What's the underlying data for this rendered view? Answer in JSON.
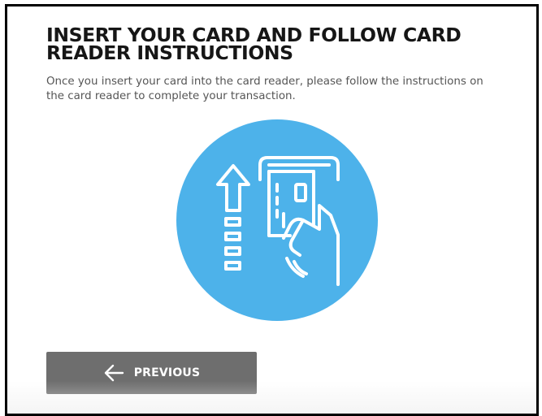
{
  "header": {
    "title": "INSERT YOUR CARD AND FOLLOW CARD READER INSTRUCTIONS"
  },
  "main": {
    "description": "Once you insert your card into the card reader, please follow the instructions on the card reader to complete your transaction.",
    "illustration": {
      "icon": "card-reader-insert-icon",
      "circle_color": "#4db2ea",
      "line_color": "#ffffff"
    }
  },
  "footer": {
    "previous_label": "PREVIOUS",
    "previous_icon": "arrow-left-icon",
    "button_color": "#6e6e6e"
  }
}
